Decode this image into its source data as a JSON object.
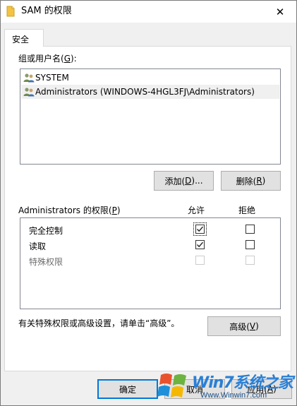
{
  "window": {
    "title": "SAM 的权限",
    "close_glyph": "✕"
  },
  "tabs": [
    {
      "label": "安全"
    }
  ],
  "groups": {
    "label_text": "组或用户名(",
    "label_key": "G",
    "label_end": "):",
    "items": [
      {
        "name": "SYSTEM",
        "icon": "user-group-icon"
      },
      {
        "name": "Administrators (WINDOWS-4HGL3FJ\\Administrators)",
        "icon": "user-group-icon",
        "selected": true
      }
    ],
    "add_button": {
      "text": "添加(",
      "key": "D",
      "end": ")..."
    },
    "remove_button": {
      "text": "删除(",
      "key": "R",
      "end": ")"
    }
  },
  "permissions": {
    "label_text": "Administrators 的权限(",
    "label_key": "P",
    "label_end": ")",
    "allow_header": "允许",
    "deny_header": "拒绝",
    "rows": [
      {
        "name": "完全控制",
        "allow": true,
        "deny": false,
        "enabled": true,
        "focused": true
      },
      {
        "name": "读取",
        "allow": true,
        "deny": false,
        "enabled": true
      },
      {
        "name": "特殊权限",
        "allow": false,
        "deny": false,
        "enabled": false
      }
    ]
  },
  "advanced": {
    "note": "有关特殊权限或高级设置，请单击“高级”。",
    "button": {
      "text": "高级(",
      "key": "V",
      "end": ")"
    }
  },
  "footer": {
    "ok": "确定",
    "cancel": {
      "text": "取消"
    },
    "apply": {
      "text": "应用(",
      "key": "A",
      "end": ")"
    }
  },
  "watermark": {
    "brand": "Win7系统之家",
    "url": "Www.Winwin7.com"
  },
  "colors": {
    "accent": "#0078d7",
    "border": "#828790",
    "button_bg": "#e1e1e1",
    "folder": "#f5c342"
  }
}
